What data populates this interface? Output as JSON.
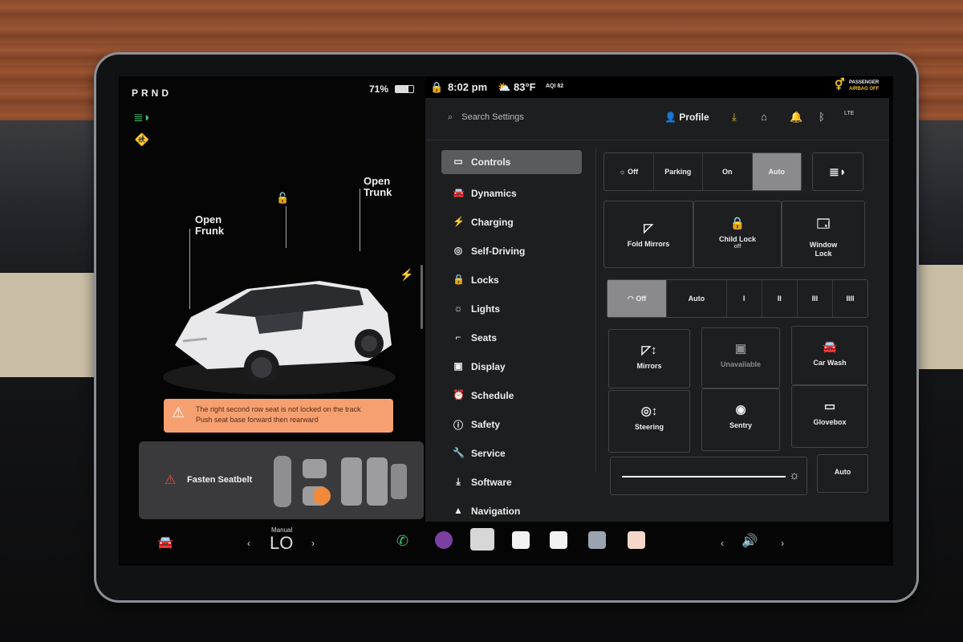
{
  "status": {
    "gear": "PRND",
    "battery": "71%",
    "battery_level": 0.71,
    "time": "8:02 pm",
    "temperature": "83°F",
    "aqi": "AQI 82",
    "airbag_line1": "PASSENGER",
    "airbag_line2": "AIRBAG OFF"
  },
  "car": {
    "open_frunk": [
      "Open",
      "Frunk"
    ],
    "open_trunk": [
      "Open",
      "Trunk"
    ]
  },
  "alert": {
    "line1": "The right second row seat is not locked on the track",
    "line2": "Push seat base forward then rearward"
  },
  "seatbelt": {
    "label": "Fasten Seatbelt"
  },
  "settings": {
    "search_placeholder": "Search Settings",
    "profile": "Profile",
    "lte": "LTE",
    "menu": [
      {
        "label": "Controls",
        "icon": "toggle-icon",
        "glyph": "▭"
      },
      {
        "label": "Dynamics",
        "icon": "car-icon",
        "glyph": "🚘"
      },
      {
        "label": "Charging",
        "icon": "bolt-icon",
        "glyph": "⚡"
      },
      {
        "label": "Self-Driving",
        "icon": "steering-wheel-icon",
        "glyph": "◎"
      },
      {
        "label": "Locks",
        "icon": "lock-icon",
        "glyph": "🔒"
      },
      {
        "label": "Lights",
        "icon": "light-icon",
        "glyph": "☼"
      },
      {
        "label": "Seats",
        "icon": "seat-icon",
        "glyph": "⌐"
      },
      {
        "label": "Display",
        "icon": "display-icon",
        "glyph": "▣"
      },
      {
        "label": "Schedule",
        "icon": "alarm-icon",
        "glyph": "⏰"
      },
      {
        "label": "Safety",
        "icon": "safety-icon",
        "glyph": "ⓘ"
      },
      {
        "label": "Service",
        "icon": "wrench-icon",
        "glyph": "🔧"
      },
      {
        "label": "Software",
        "icon": "download-icon",
        "glyph": "⤓"
      },
      {
        "label": "Navigation",
        "icon": "navigation-icon",
        "glyph": "▲"
      }
    ],
    "headlights": {
      "off": "Off",
      "parking": "Parking",
      "on": "On",
      "auto": "Auto",
      "selected": "Auto"
    },
    "mirror_tiles": {
      "fold_mirrors": "Fold Mirrors",
      "child_lock": "Child Lock",
      "child_lock_state": "off",
      "window_lock": [
        "Window",
        "Lock"
      ]
    },
    "wipers": {
      "off": "Off",
      "auto": "Auto",
      "levels": [
        "I",
        "II",
        "III",
        "IIII"
      ],
      "selected": "Off"
    },
    "adjust_tiles": {
      "mirrors": "Mirrors",
      "unavailable": "Unavailable",
      "car_wash": "Car Wash",
      "steering": "Steering",
      "sentry": "Sentry",
      "glovebox": "Glovebox"
    },
    "brightness_auto": "Auto"
  },
  "bottom": {
    "climate_mode": "Manual",
    "climate_temp": "LO"
  },
  "colors": {
    "settings_bg": "#1d1e20",
    "alert_bg": "#f6a071",
    "active_menu": "#5a5b5e",
    "seatbelt_red": "#f04b3b",
    "indicator_green": "#3ec36b",
    "download_yellow": "#f2c12e"
  }
}
